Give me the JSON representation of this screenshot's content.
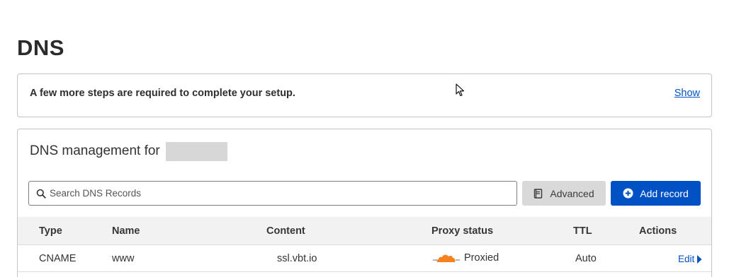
{
  "page": {
    "title": "DNS"
  },
  "setup_banner": {
    "message": "A few more steps are required to complete your setup.",
    "show_link": "Show"
  },
  "dns_management": {
    "title": "DNS management for",
    "search": {
      "placeholder": "Search DNS Records",
      "value": ""
    },
    "advanced_label": "Advanced",
    "add_record_label": "Add record",
    "columns": {
      "type": "Type",
      "name": "Name",
      "content": "Content",
      "proxy_status": "Proxy status",
      "ttl": "TTL",
      "actions": "Actions"
    },
    "records": [
      {
        "type": "CNAME",
        "name": "www",
        "content": "ssl.vbt.io",
        "proxy_status": "Proxied",
        "ttl": "Auto",
        "action": "Edit"
      }
    ]
  },
  "colors": {
    "accent": "#0051c3",
    "cloud": "#f6821f",
    "header_bg": "#f2f2f2"
  },
  "icons": [
    "search-icon",
    "book-icon",
    "plus-circle-icon",
    "cloud-icon",
    "caret-right-icon",
    "cursor-icon"
  ]
}
